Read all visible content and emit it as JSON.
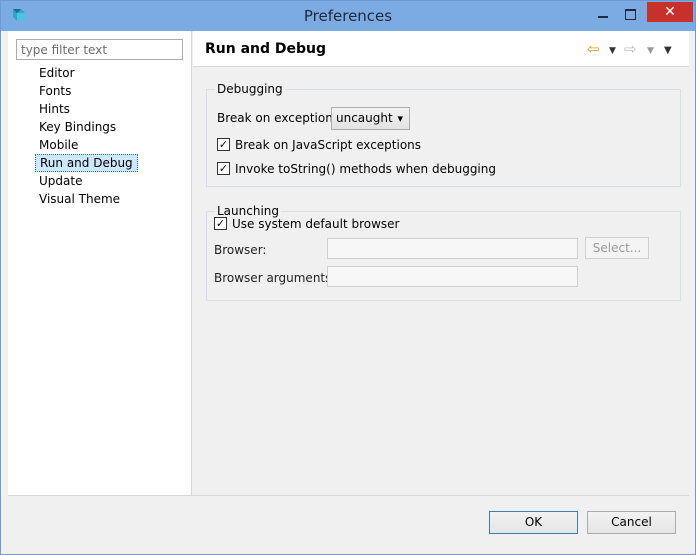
{
  "window": {
    "title": "Preferences",
    "close_glyph": "✕"
  },
  "filter": {
    "placeholder": "type filter text"
  },
  "tree": {
    "items": [
      "Editor",
      "Fonts",
      "Hints",
      "Key Bindings",
      "Mobile",
      "Run and Debug",
      "Update",
      "Visual Theme"
    ],
    "selected": "Run and Debug"
  },
  "page": {
    "title": "Run and Debug",
    "nav": {
      "back_icon": "back-arrow-icon",
      "forward_icon": "forward-arrow-icon",
      "menu_icon": "view-menu-icon"
    }
  },
  "debugging": {
    "group_label": "Debugging",
    "break_label": "Break on exceptions:",
    "break_value": "uncaught",
    "break_js_label": "Break on JavaScript exceptions",
    "break_js_checked": true,
    "invoke_tostring_label": "Invoke toString() methods when debugging",
    "invoke_tostring_checked": true
  },
  "launching": {
    "group_label": "Launching",
    "use_system_label": "Use system default browser",
    "use_system_checked": true,
    "browser_label": "Browser:",
    "browser_value": "",
    "select_button": "Select...",
    "browser_args_label": "Browser arguments:",
    "browser_args_value": ""
  },
  "footer": {
    "ok": "OK",
    "cancel": "Cancel"
  },
  "colors": {
    "titlebar": "#7cabe3",
    "close": "#c7312b",
    "selection": "#cde8ff"
  }
}
